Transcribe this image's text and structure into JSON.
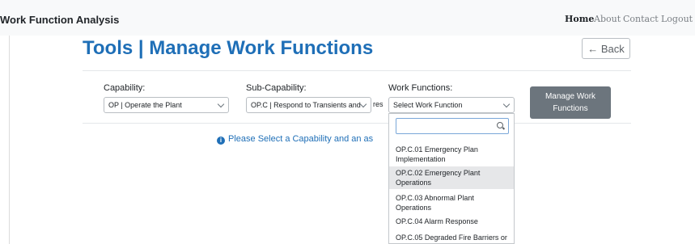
{
  "navbar": {
    "brand": "Work Function Analysis",
    "links": [
      "Home",
      "About",
      "Contact",
      "Logout"
    ]
  },
  "page": {
    "title": "Tools | Manage Work Functions",
    "back_label": "← Back"
  },
  "form": {
    "capability": {
      "label": "Capability:",
      "value": "OP | Operate the Plant"
    },
    "sub_capability": {
      "label": "Sub-Capability:",
      "value": "OP.C | Respond to Transients and"
    },
    "work_functions": {
      "label": "Work Functions:",
      "value": "Select Work Function"
    },
    "truncated_text": "res",
    "manage_button": "Manage Work Functions"
  },
  "info_message": "Please Select a Capability and an as",
  "dropdown": {
    "search_value": "",
    "options": [
      "OP.C.01 Emergency Plan Implementation",
      "OP.C.02 Emergency Plant Operations",
      "OP.C.03 Abnormal Plant Operations",
      "OP.C.04 Alarm Response",
      "OP.C.05 Degraded Fire Barriers or"
    ],
    "highlighted_index": 1
  },
  "colors": {
    "accent": "#1f6fb7",
    "button_gray": "#6c757d",
    "navbar_bg": "#f8f9fa"
  }
}
